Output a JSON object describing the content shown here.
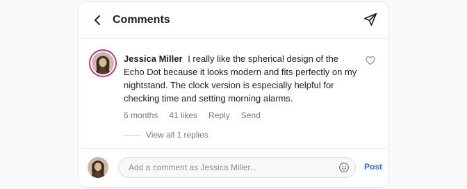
{
  "header": {
    "title": "Comments",
    "back_icon": "chevron-left-icon",
    "share_icon": "paper-plane-icon"
  },
  "comment": {
    "author": "Jessica Miller",
    "text": "I really like the spherical design of the Echo Dot because it looks modern and fits perfectly on my nightstand. The clock version is especially helpful for checking time and setting morning alarms.",
    "time": "6 months",
    "likes": "41 likes",
    "reply_label": "Reply",
    "send_label": "Send",
    "view_replies": "View all 1 replies",
    "like_icon": "heart-outline-icon"
  },
  "composer": {
    "placeholder": "Add a comment as Jessica Miller...",
    "value": "",
    "post_label": "Post",
    "emoji_icon": "smiley-face-icon"
  },
  "colors": {
    "accent": "#2d6fe0",
    "avatar_ring": "#c13584",
    "muted_text": "#737780"
  }
}
